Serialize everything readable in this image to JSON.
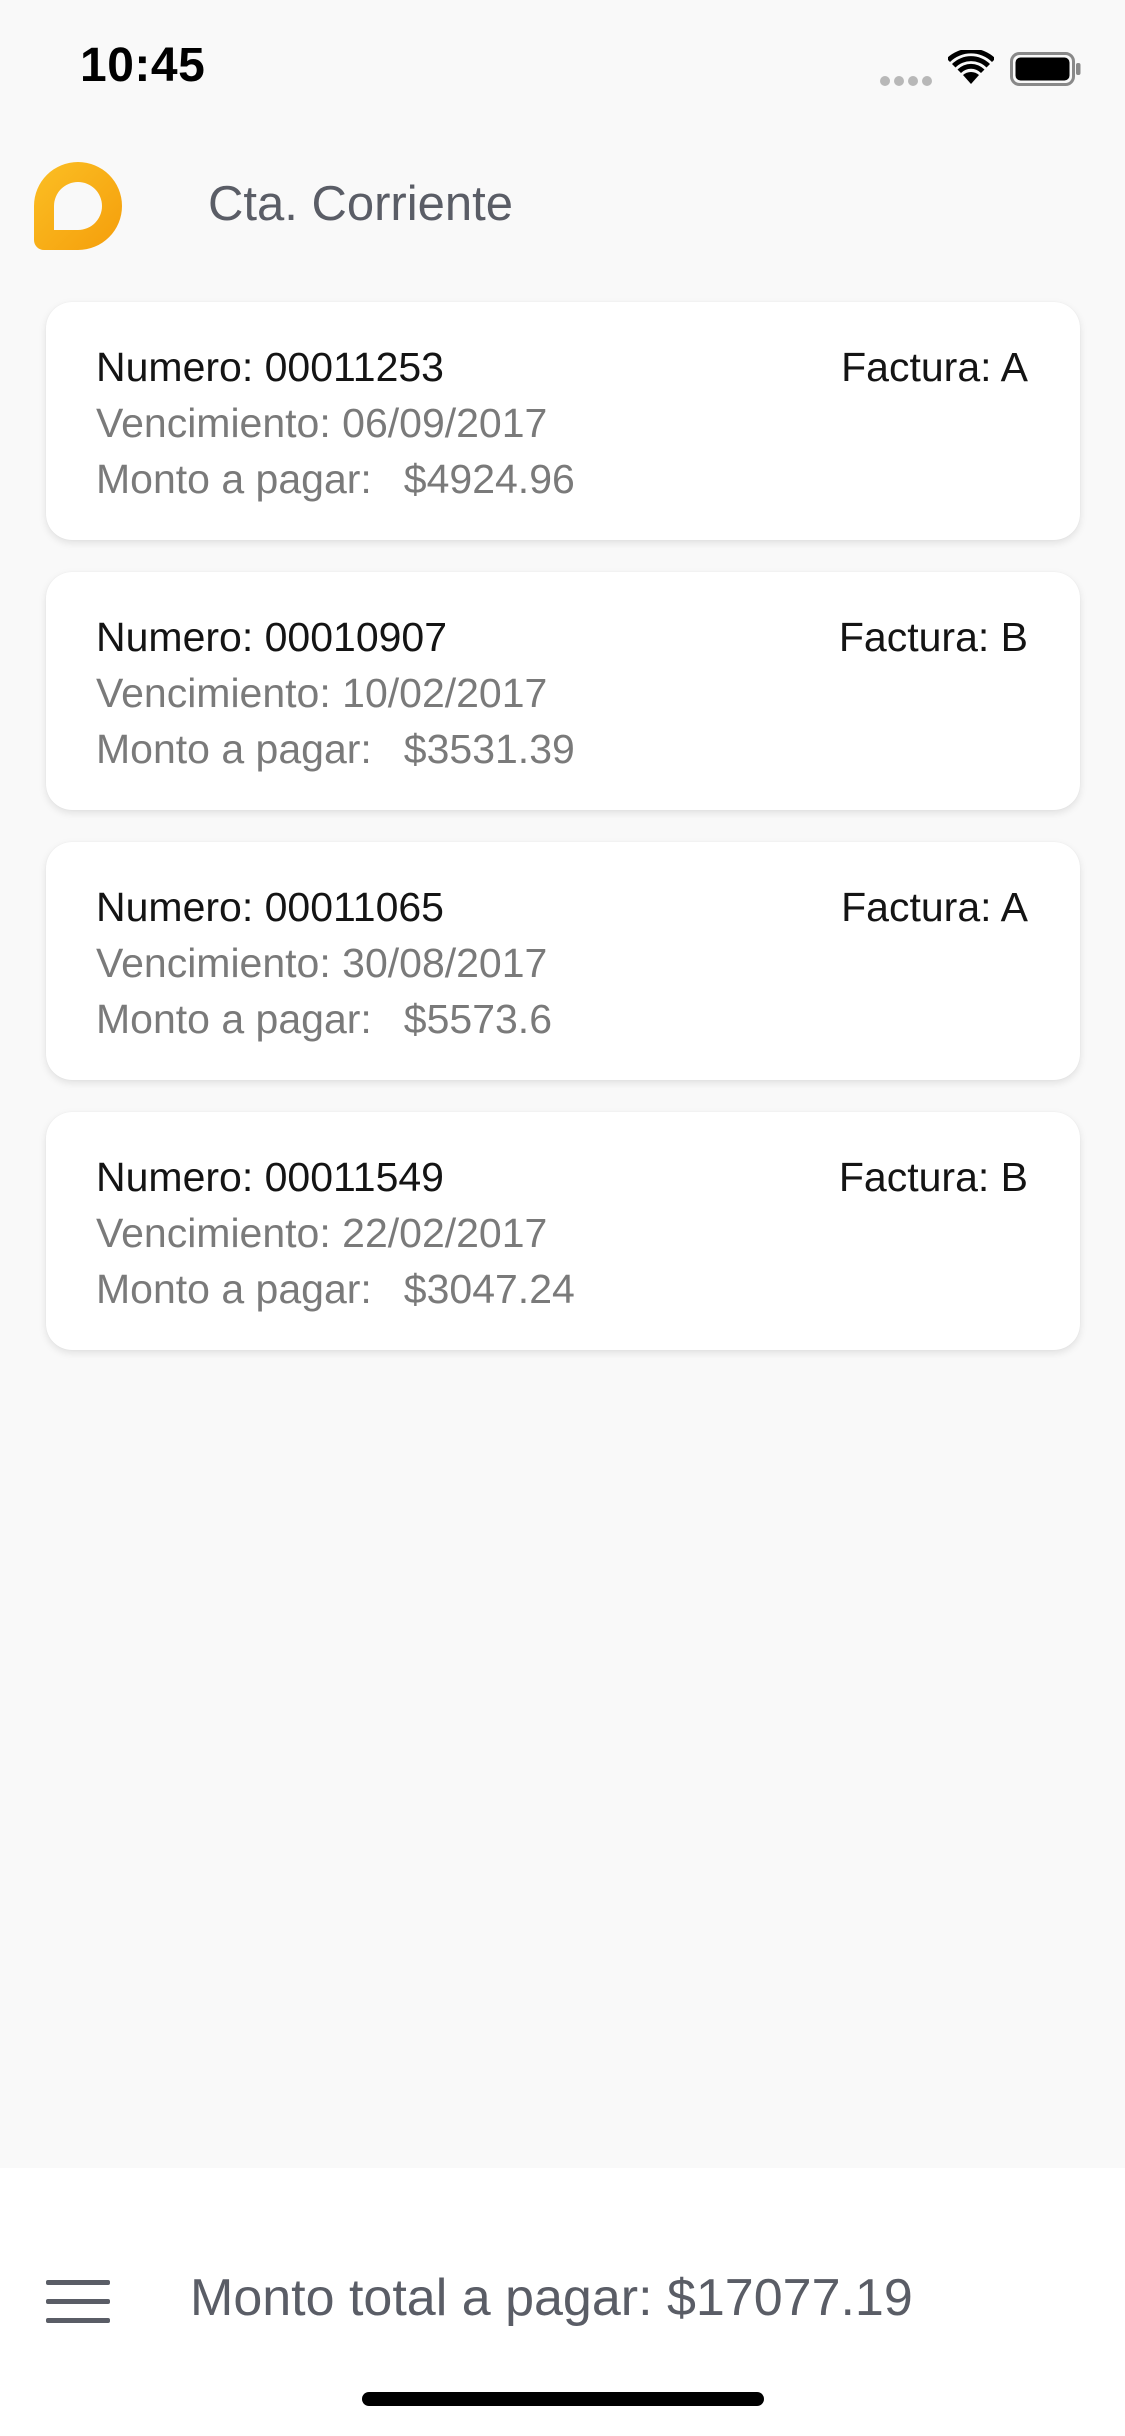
{
  "status_bar": {
    "time": "10:45"
  },
  "header": {
    "title": "Cta. Corriente",
    "logo_color": "#f7a51b"
  },
  "invoices": [
    {
      "number_label": "Numero: 00011253",
      "type_label": "Factura: A",
      "due_label": "Vencimiento: 06/09/2017",
      "amount_label": "Monto a pagar:",
      "amount": "$4924.96"
    },
    {
      "number_label": "Numero: 00010907",
      "type_label": "Factura: B",
      "due_label": "Vencimiento: 10/02/2017",
      "amount_label": "Monto a pagar:",
      "amount": "$3531.39"
    },
    {
      "number_label": "Numero: 00011065",
      "type_label": "Factura: A",
      "due_label": "Vencimiento: 30/08/2017",
      "amount_label": "Monto a pagar:",
      "amount": "$5573.6"
    },
    {
      "number_label": "Numero: 00011549",
      "type_label": "Factura: B",
      "due_label": "Vencimiento: 22/02/2017",
      "amount_label": "Monto a pagar:",
      "amount": "$3047.24"
    }
  ],
  "footer": {
    "total_label": "Monto total a pagar: $17077.19",
    "menu_icon": "hamburger-menu-icon"
  }
}
